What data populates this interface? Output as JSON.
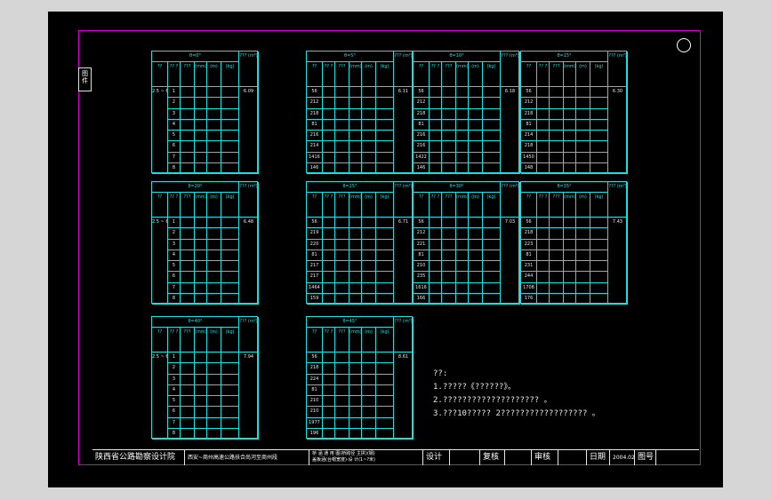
{
  "drawing": {
    "side_tab": "图\n件",
    "notes": {
      "heading": "??:",
      "lines": [
        "1.?????《??????》。",
        "2.????????????????????     。",
        "3.???10?????   2??????????????????     。"
      ]
    },
    "title_block": {
      "org": "陕西省公路勘察设计院",
      "project": "西安~商州高速公路扶合尚河至商州段",
      "drawing_title_1": "桥 涵 通 用 图(桥跨径 主拱)(钢)",
      "drawing_title_2": "盖板涵(台帽宽度)·设 计(1~?米)",
      "design_label": "设计",
      "review_label": "复核",
      "audit_label": "审核",
      "date_label": "日期",
      "date_value": "2004.02",
      "sheet_label": "图号"
    },
    "tables": [
      {
        "header": "θ=0°",
        "summary": "6.09",
        "vals": [
          "1",
          "2",
          "3",
          "4",
          "5",
          "6",
          "7",
          "8"
        ]
      },
      {
        "header": "θ=5°",
        "summary": "6.11",
        "vals": [
          "56",
          "212",
          "218",
          "81",
          "216",
          "214",
          "1416",
          "146"
        ]
      },
      {
        "header": "θ=10°",
        "summary": "6.18",
        "vals": [
          "56",
          "212",
          "218",
          "81",
          "216",
          "216",
          "1422",
          "146"
        ]
      },
      {
        "header": "θ=15°",
        "summary": "6.30",
        "vals": [
          "56",
          "212",
          "218",
          "81",
          "214",
          "218",
          "1450",
          "148"
        ]
      },
      {
        "header": "θ=20°",
        "summary": "6.48",
        "vals": [
          "1",
          "2",
          "3",
          "4",
          "5",
          "6",
          "7",
          "8"
        ]
      },
      {
        "header": "θ=25°",
        "summary": "6.71",
        "vals": [
          "56",
          "219",
          "220",
          "81",
          "217",
          "217",
          "1464",
          "159"
        ]
      },
      {
        "header": "θ=30°",
        "summary": "7.03",
        "vals": [
          "56",
          "212",
          "221",
          "81",
          "210",
          "235",
          "1616",
          "166"
        ]
      },
      {
        "header": "θ=35°",
        "summary": "7.43",
        "vals": [
          "56",
          "218",
          "223",
          "81",
          "231",
          "244",
          "1708",
          "176"
        ]
      },
      {
        "header": "θ=40°",
        "summary": "7.94",
        "vals": [
          "1",
          "2",
          "3",
          "4",
          "5",
          "6",
          "7",
          "8"
        ]
      },
      {
        "header": "θ=45°",
        "summary": "8.61",
        "vals": [
          "56",
          "218",
          "224",
          "81",
          "210",
          "210",
          "1977",
          "196"
        ]
      }
    ],
    "col_labels": [
      "??",
      "?? ?",
      "???",
      "(mm)",
      "(m)",
      "(kg)"
    ],
    "row_label_range": "2.5 ~ 6.0"
  }
}
